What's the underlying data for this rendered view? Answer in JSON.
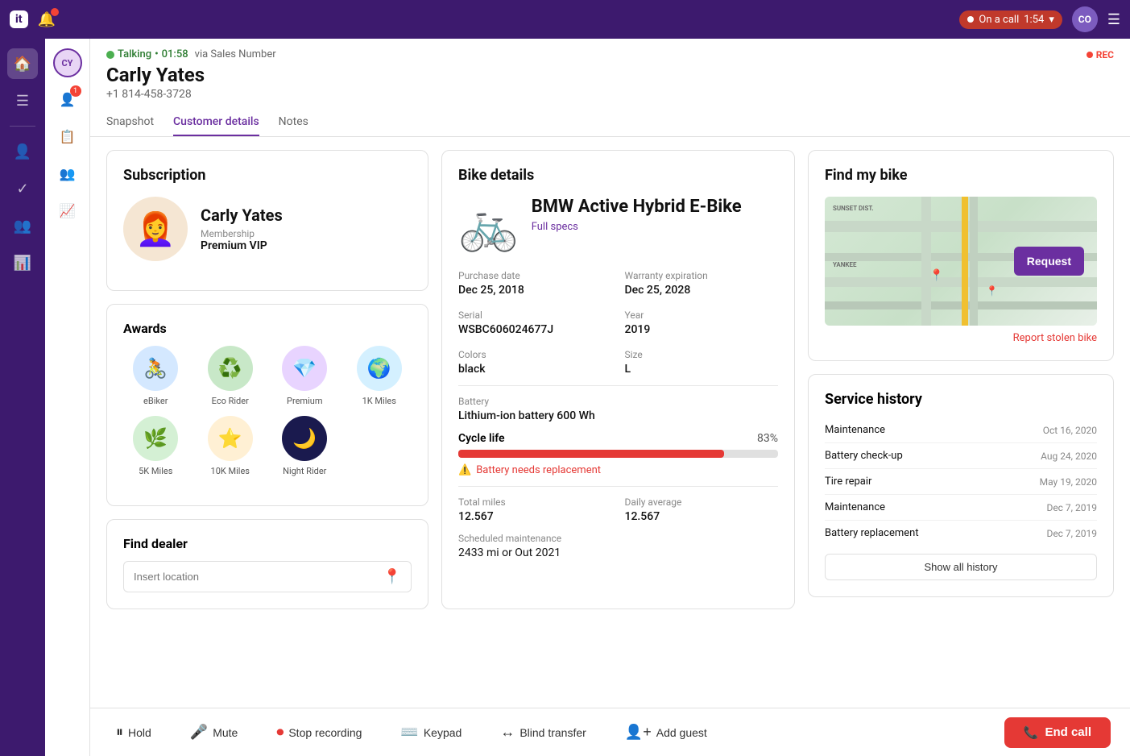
{
  "app": {
    "logo": "it",
    "top_right_avatar": "CO"
  },
  "call": {
    "status": "Talking",
    "duration": "01:58",
    "via": "via Sales Number",
    "rec_label": "REC",
    "customer_name": "Carly Yates",
    "customer_phone": "+1 814-458-3728"
  },
  "tabs": [
    {
      "id": "snapshot",
      "label": "Snapshot"
    },
    {
      "id": "customer_details",
      "label": "Customer details"
    },
    {
      "id": "notes",
      "label": "Notes"
    }
  ],
  "active_tab": "customer_details",
  "subscription": {
    "title": "Subscription",
    "name": "Carly Yates",
    "membership_label": "Membership",
    "membership": "Premium VIP"
  },
  "awards": {
    "title": "Awards",
    "items": [
      {
        "id": "ebiker",
        "label": "eBiker",
        "emoji": "🚴",
        "bg": "#d4e8ff"
      },
      {
        "id": "eco_rider",
        "label": "Eco Rider",
        "emoji": "♻️",
        "bg": "#c8e8c8"
      },
      {
        "id": "premium",
        "label": "Premium",
        "emoji": "💎",
        "bg": "#e8d4ff"
      },
      {
        "id": "1k_miles",
        "label": "1K Miles",
        "emoji": "🌍",
        "bg": "#d4f0ff"
      },
      {
        "id": "5k_miles",
        "label": "5K Miles",
        "emoji": "🌿",
        "bg": "#d4f0d4"
      },
      {
        "id": "10k_miles",
        "label": "10K Miles",
        "emoji": "⭐",
        "bg": "#fff0d4"
      },
      {
        "id": "night_rider",
        "label": "Night Rider",
        "emoji": "🌙",
        "bg": "#1a1a4e"
      }
    ]
  },
  "find_dealer": {
    "title": "Find dealer",
    "placeholder": "Insert location"
  },
  "bike_details": {
    "title": "Bike details",
    "model": "BMW Active Hybrid E-Bike",
    "specs_link": "Full specs",
    "purchase_date_label": "Purchase date",
    "purchase_date": "Dec 25, 2018",
    "warranty_label": "Warranty expiration",
    "warranty": "Dec 25, 2028",
    "serial_label": "Serial",
    "serial": "WSBC606024677J",
    "year_label": "Year",
    "year": "2019",
    "colors_label": "Colors",
    "colors": "black",
    "size_label": "Size",
    "size": "L",
    "battery_label": "Battery",
    "battery": "Lithium-ion battery 600 Wh",
    "cycle_life_label": "Cycle life",
    "cycle_life_pct": "83%",
    "cycle_life_value": 83,
    "battery_warning": "Battery needs replacement",
    "total_miles_label": "Total miles",
    "total_miles": "12.567",
    "daily_avg_label": "Daily average",
    "daily_avg": "12.567",
    "scheduled_maint_label": "Scheduled maintenance",
    "scheduled_maint": "2433 mi or Out 2021"
  },
  "find_my_bike": {
    "title": "Find my bike",
    "request_btn": "Request",
    "report_stolen": "Report stolen bike"
  },
  "service_history": {
    "title": "Service history",
    "items": [
      {
        "type": "Maintenance",
        "date": "Oct 16, 2020"
      },
      {
        "type": "Battery check-up",
        "date": "Aug 24, 2020"
      },
      {
        "type": "Tire repair",
        "date": "May 19, 2020"
      },
      {
        "type": "Maintenance",
        "date": "Dec 7, 2019"
      },
      {
        "type": "Battery replacement",
        "date": "Dec 7, 2019"
      }
    ],
    "show_all_btn": "Show all history"
  },
  "toolbar": {
    "hold": "Hold",
    "mute": "Mute",
    "stop_recording": "Stop recording",
    "keypad": "Keypad",
    "blind_transfer": "Blind transfer",
    "add_guest": "Add guest",
    "end_call": "End call"
  }
}
